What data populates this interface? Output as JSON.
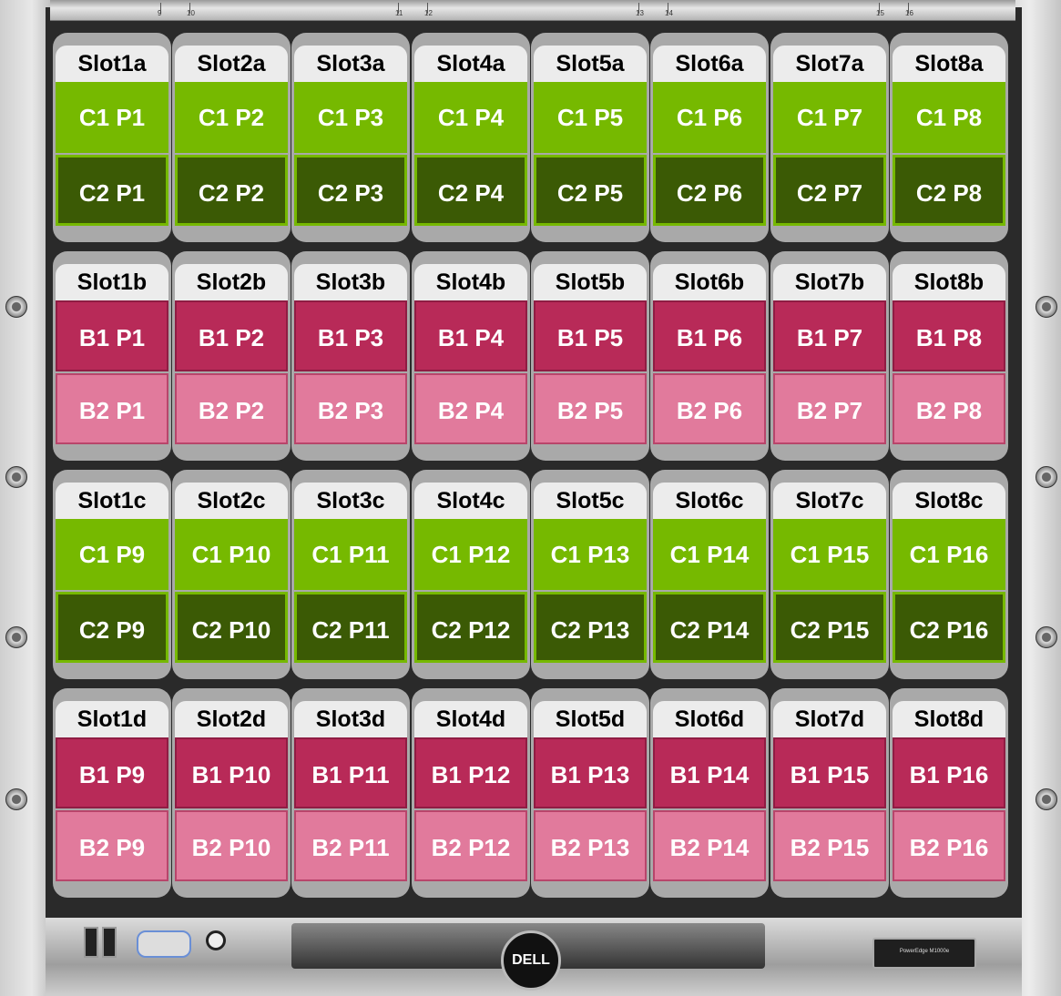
{
  "chassis": {
    "brand_logo": "DELL",
    "model_label": "PowerEdge M1000e",
    "top_numbers": [
      "9",
      "10",
      "11",
      "12",
      "13",
      "14",
      "15",
      "16"
    ]
  },
  "colors": {
    "c1": "#76b900",
    "c2": "#3b5a05",
    "b1": "#b82a58",
    "b2": "#e17a9c",
    "slot_label_bg": "#ececec"
  },
  "rows": [
    {
      "slots": [
        "Slot1a",
        "Slot2a",
        "Slot3a",
        "Slot4a",
        "Slot5a",
        "Slot6a",
        "Slot7a",
        "Slot8a"
      ],
      "port1": [
        "C1 P1",
        "C1 P2",
        "C1 P3",
        "C1 P4",
        "C1 P5",
        "C1 P6",
        "C1 P7",
        "C1 P8"
      ],
      "port2": [
        "C2 P1",
        "C2 P2",
        "C2 P3",
        "C2 P4",
        "C2 P5",
        "C2 P6",
        "C2 P7",
        "C2 P8"
      ]
    },
    {
      "slots": [
        "Slot1b",
        "Slot2b",
        "Slot3b",
        "Slot4b",
        "Slot5b",
        "Slot6b",
        "Slot7b",
        "Slot8b"
      ],
      "port1": [
        "B1 P1",
        "B1 P2",
        "B1 P3",
        "B1 P4",
        "B1 P5",
        "B1 P6",
        "B1 P7",
        "B1 P8"
      ],
      "port2": [
        "B2 P1",
        "B2 P2",
        "B2 P3",
        "B2 P4",
        "B2 P5",
        "B2 P6",
        "B2 P7",
        "B2 P8"
      ]
    },
    {
      "slots": [
        "Slot1c",
        "Slot2c",
        "Slot3c",
        "Slot4c",
        "Slot5c",
        "Slot6c",
        "Slot7c",
        "Slot8c"
      ],
      "port1": [
        "C1 P9",
        "C1 P10",
        "C1 P11",
        "C1 P12",
        "C1 P13",
        "C1 P14",
        "C1 P15",
        "C1 P16"
      ],
      "port2": [
        "C2 P9",
        "C2 P10",
        "C2 P11",
        "C2 P12",
        "C2 P13",
        "C2 P14",
        "C2 P15",
        "C2 P16"
      ]
    },
    {
      "slots": [
        "Slot1d",
        "Slot2d",
        "Slot3d",
        "Slot4d",
        "Slot5d",
        "Slot6d",
        "Slot7d",
        "Slot8d"
      ],
      "port1": [
        "B1 P9",
        "B1 P10",
        "B1 P11",
        "B1 P12",
        "B1 P13",
        "B1 P14",
        "B1 P15",
        "B1 P16"
      ],
      "port2": [
        "B2 P9",
        "B2 P10",
        "B2 P11",
        "B2 P12",
        "B2 P13",
        "B2 P14",
        "B2 P15",
        "B2 P16"
      ]
    }
  ]
}
